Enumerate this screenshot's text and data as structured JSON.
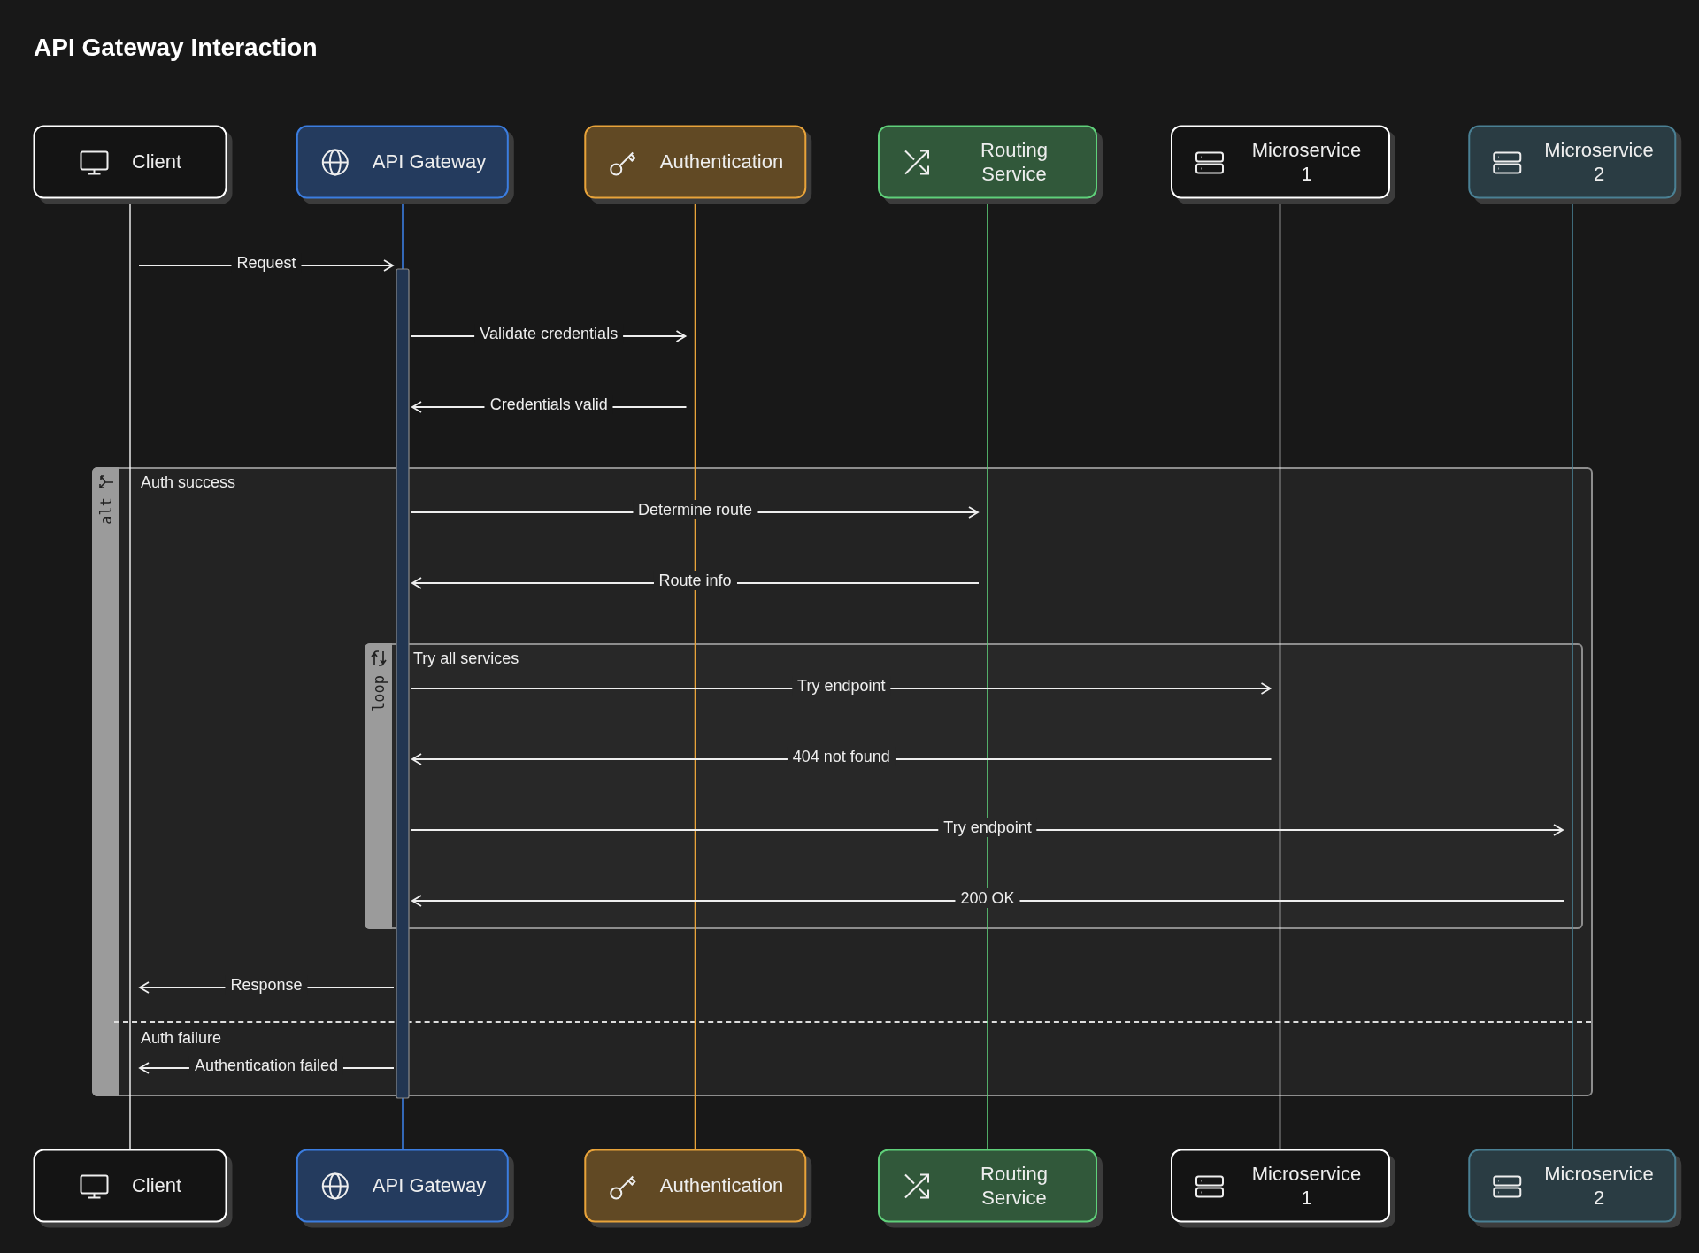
{
  "title": "API Gateway Interaction",
  "participants": [
    {
      "label": "Client",
      "bottom_label": "Client",
      "kind": "client",
      "color": "#ffffff"
    },
    {
      "label": "API Gateway",
      "bottom_label": "API Gateway",
      "kind": "gateway",
      "color": "#3b7de0"
    },
    {
      "label": "Authentication",
      "bottom_label": "Authentication",
      "kind": "auth",
      "color": "#e8a33a"
    },
    {
      "label": "Routing Service",
      "bottom_label": "Routing Service",
      "kind": "router",
      "color": "#5fd07a"
    },
    {
      "label": "Microservice 1",
      "bottom_label": "Microservice 1",
      "kind": "service",
      "color": "#ffffff"
    },
    {
      "label": "Microservice 2",
      "bottom_label": "Microservice 2",
      "kind": "service",
      "color": "#4a8094"
    }
  ],
  "sequence": [
    {
      "kind": "right",
      "ends": [
        true,
        true,
        false,
        false,
        false,
        false
      ],
      "label": "Request"
    },
    {
      "kind": "right",
      "ends": [
        false,
        true,
        true,
        false,
        false,
        false
      ],
      "label": "Validate credentials"
    },
    {
      "kind": "left",
      "ends": [
        false,
        true,
        true,
        false,
        false,
        false
      ],
      "label": "Credentials valid"
    },
    {
      "kind": "alt",
      "operator": "alt",
      "sections": [
        {
          "label": "Auth success",
          "steps": [
            {
              "kind": "right",
              "ends": [
                false,
                true,
                false,
                true,
                false,
                false
              ],
              "label": "Determine route"
            },
            {
              "kind": "left",
              "ends": [
                false,
                true,
                false,
                true,
                false,
                false
              ],
              "label": "Route info"
            },
            {
              "kind": "loop",
              "operator": "loop",
              "sections": [
                {
                  "label": "Try all services",
                  "steps": [
                    {
                      "kind": "right",
                      "ends": [
                        false,
                        true,
                        false,
                        false,
                        true,
                        false
                      ],
                      "label": "Try endpoint"
                    },
                    {
                      "kind": "left",
                      "ends": [
                        false,
                        true,
                        false,
                        false,
                        true,
                        false
                      ],
                      "label": "404 not found"
                    },
                    {
                      "kind": "right",
                      "ends": [
                        false,
                        true,
                        false,
                        false,
                        false,
                        true
                      ],
                      "label": "Try endpoint"
                    },
                    {
                      "kind": "left",
                      "ends": [
                        false,
                        true,
                        false,
                        false,
                        false,
                        true
                      ],
                      "label": "200 OK"
                    }
                  ]
                }
              ]
            },
            {
              "kind": "left",
              "ends": [
                true,
                true,
                false,
                false,
                false,
                false
              ],
              "label": "Response"
            }
          ]
        },
        {
          "label": "Auth failure",
          "steps": [
            {
              "kind": "left",
              "ends": [
                true,
                true,
                false,
                false,
                false,
                false
              ],
              "label": "Authentication failed"
            }
          ]
        }
      ]
    }
  ]
}
